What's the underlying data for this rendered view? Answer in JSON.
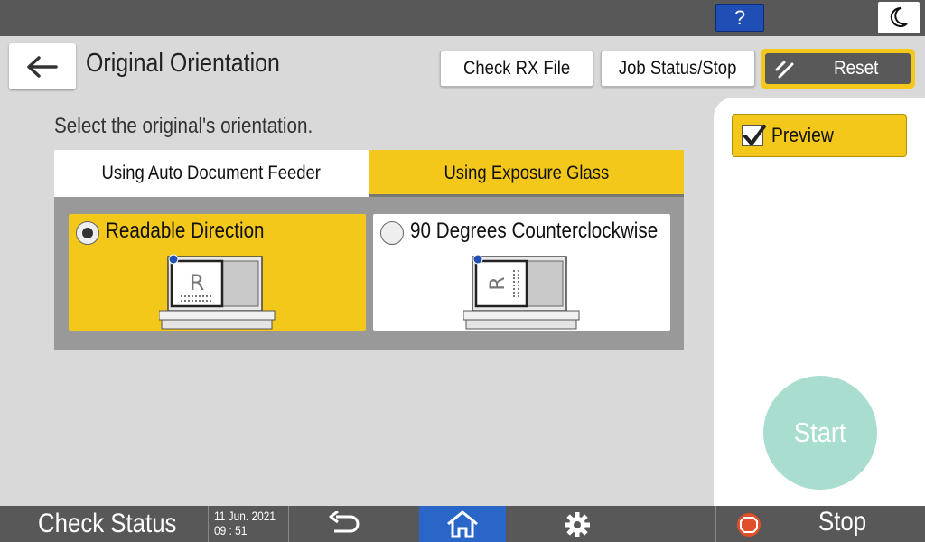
{
  "topbar": {
    "help_label": "?"
  },
  "header": {
    "title": "Original Orientation",
    "check_rx_label": "Check RX File",
    "job_status_label": "Job Status/Stop",
    "reset_label": "Reset"
  },
  "main": {
    "instruction": "Select the original's orientation.",
    "tabs": [
      {
        "label": "Using Auto Document Feeder",
        "selected": false
      },
      {
        "label": "Using Exposure Glass",
        "selected": true
      }
    ],
    "options": [
      {
        "label": "Readable Direction",
        "selected": true
      },
      {
        "label": "90 Degrees Counterclockwise",
        "selected": false
      }
    ]
  },
  "side": {
    "preview_label": "Preview",
    "preview_checked": true,
    "start_label": "Start"
  },
  "bottombar": {
    "check_status_label": "Check Status",
    "date": "11 Jun. 2021",
    "time": "09 : 51",
    "stop_label": "Stop"
  },
  "colors": {
    "accent_yellow": "#f3c81a",
    "home_blue": "#2a66c8",
    "start_teal": "#a8ddd0",
    "bar_gray": "#585858"
  },
  "icons": [
    "question-icon",
    "moon-icon",
    "back-arrow-icon",
    "reset-icon",
    "checkmark-icon",
    "return-icon",
    "home-icon",
    "gear-icon",
    "stop-icon",
    "scanner-icon"
  ]
}
